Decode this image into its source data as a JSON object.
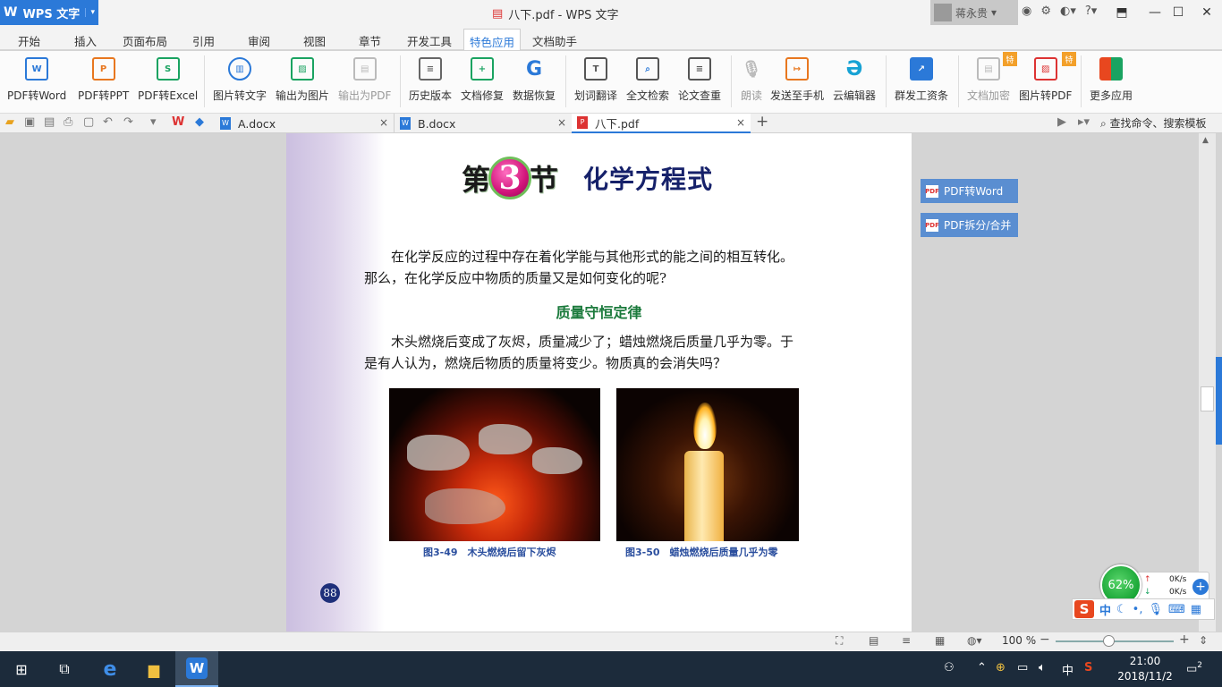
{
  "titlebar": {
    "app_name": "WPS 文字",
    "window_title": "八下.pdf - WPS 文字",
    "user_name": "蒋永贵",
    "help_label": "?"
  },
  "menubar": {
    "items": [
      "开始",
      "插入",
      "页面布局",
      "引用",
      "审阅",
      "视图",
      "章节",
      "开发工具",
      "特色应用",
      "文档助手"
    ],
    "active": "特色应用"
  },
  "ribbon": {
    "buttons": [
      {
        "label": "PDF转Word",
        "icon": "pdf-to-word-icon"
      },
      {
        "label": "PDF转PPT",
        "icon": "pdf-to-ppt-icon"
      },
      {
        "label": "PDF转Excel",
        "icon": "pdf-to-excel-icon"
      },
      {
        "label": "图片转文字",
        "icon": "image-to-text-icon"
      },
      {
        "label": "输出为图片",
        "icon": "export-image-icon"
      },
      {
        "label": "输出为PDF",
        "icon": "export-pdf-icon",
        "disabled": true
      },
      {
        "label": "历史版本",
        "icon": "history-icon"
      },
      {
        "label": "文档修复",
        "icon": "repair-icon"
      },
      {
        "label": "数据恢复",
        "icon": "recovery-icon"
      },
      {
        "label": "划词翻译",
        "icon": "translate-icon"
      },
      {
        "label": "全文检索",
        "icon": "fulltext-search-icon"
      },
      {
        "label": "论文查重",
        "icon": "plagiarism-check-icon"
      },
      {
        "label": "朗读",
        "icon": "read-aloud-icon",
        "disabled": true
      },
      {
        "label": "发送至手机",
        "icon": "send-to-phone-icon"
      },
      {
        "label": "云编辑器",
        "icon": "cloud-editor-icon"
      },
      {
        "label": "群发工资条",
        "icon": "payslip-icon"
      },
      {
        "label": "文档加密",
        "icon": "encrypt-icon",
        "disabled": true
      },
      {
        "label": "图片转PDF",
        "icon": "image-to-pdf-icon"
      },
      {
        "label": "更多应用",
        "icon": "more-apps-icon"
      }
    ],
    "special_tag": "特"
  },
  "tabs": [
    {
      "label": "A.docx",
      "close": "×"
    },
    {
      "label": "B.docx",
      "close": "×"
    },
    {
      "label": "八下.pdf",
      "close": "×"
    }
  ],
  "new_tab": "+",
  "search_commands": "查找命令、搜索模板",
  "document": {
    "section_prefix": "第",
    "section_number": "3",
    "section_suffix": "节",
    "section_title": "化学方程式",
    "intro_line1": "在化学反应的过程中存在着化学能与其他形式的能之间的相互转化。",
    "intro_line2": "那么，在化学反应中物质的质量又是如何变化的呢?",
    "subheading": "质量守恒定律",
    "body_line1": "木头燃烧后变成了灰烬，质量减少了；蜡烛燃烧后质量几乎为零。于",
    "body_line2": "是有人认为，燃烧后物质的质量将变少。物质真的会消失吗？",
    "caption1": "图3-49　木头燃烧后留下灰烬",
    "caption2": "图3-50　蜡烛燃烧后质量几乎为零",
    "page_number": "88"
  },
  "side_panel": {
    "btn1": "PDF转Word",
    "btn2": "PDF拆分/合并",
    "pdf_badge": "PDF"
  },
  "statusbar": {
    "zoom": "100 %",
    "zoom_level": 0.45
  },
  "net_widget": {
    "percent": "62%",
    "up": "0K/s",
    "down": "0K/s"
  },
  "ime": {
    "logo": "S",
    "mode": "中"
  },
  "taskbar": {
    "tray_lang": "中",
    "time": "21:00",
    "date": "2018/11/2",
    "notifications": "2"
  }
}
